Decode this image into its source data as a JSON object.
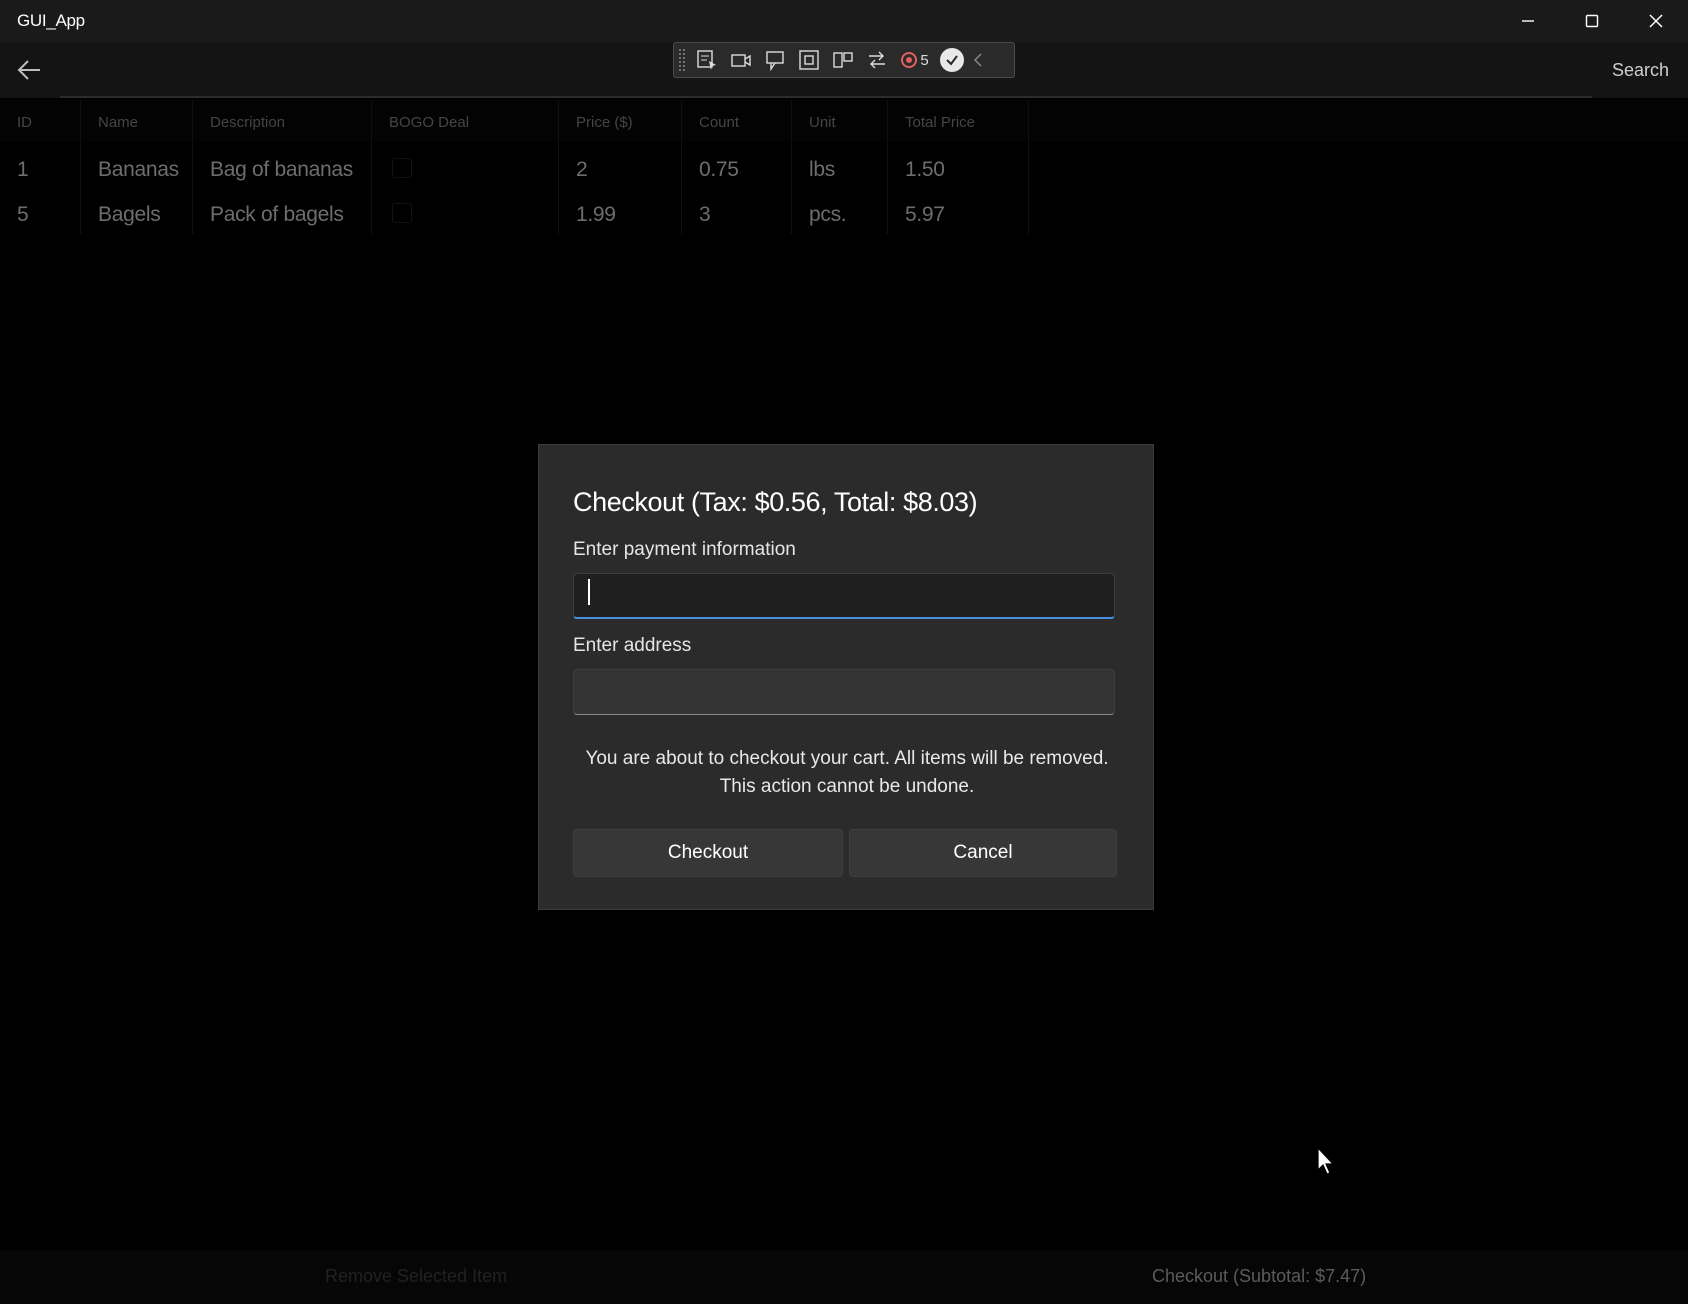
{
  "window": {
    "title": "GUI_App",
    "minimize_glyph": "—",
    "maximize_glyph": "☐",
    "close_glyph": "✕"
  },
  "nav": {
    "back_icon": "arrow-left-icon",
    "search_label": "Search"
  },
  "toolbar": {
    "icons": [
      "select-element-icon",
      "video-icon",
      "comment-icon",
      "frame-icon",
      "layout-icon",
      "swap-icon",
      "notification-icon",
      "check-icon",
      "chevron-left-icon"
    ],
    "badge_count": "5"
  },
  "table": {
    "columns": [
      "ID",
      "Name",
      "Description",
      "BOGO Deal",
      "Price ($)",
      "Count",
      "Unit",
      "Total Price"
    ],
    "rows": [
      {
        "id": "1",
        "name": "Bananas",
        "description": "Bag of bananas",
        "bogo": false,
        "price": "2",
        "count": "0.75",
        "unit": "lbs",
        "total": "1.50"
      },
      {
        "id": "5",
        "name": "Bagels",
        "description": "Pack of bagels",
        "bogo": false,
        "price": "1.99",
        "count": "3",
        "unit": "pcs.",
        "total": "5.97"
      }
    ]
  },
  "dialog": {
    "title": "Checkout (Tax: $0.56, Total: $8.03)",
    "payment_label": "Enter payment information",
    "payment_value": "",
    "address_label": "Enter address",
    "address_value": "",
    "message_line1": "You are about to checkout your cart. All items will be removed.",
    "message_line2": "This action cannot be undone.",
    "checkout_label": "Checkout",
    "cancel_label": "Cancel"
  },
  "bottom": {
    "remove_label": "Remove Selected Item",
    "checkout_label": "Checkout (Subtotal: $7.47)"
  },
  "colors": {
    "accent": "#4a8ee0",
    "background": "#000000",
    "dialog": "#2b2b2b"
  }
}
